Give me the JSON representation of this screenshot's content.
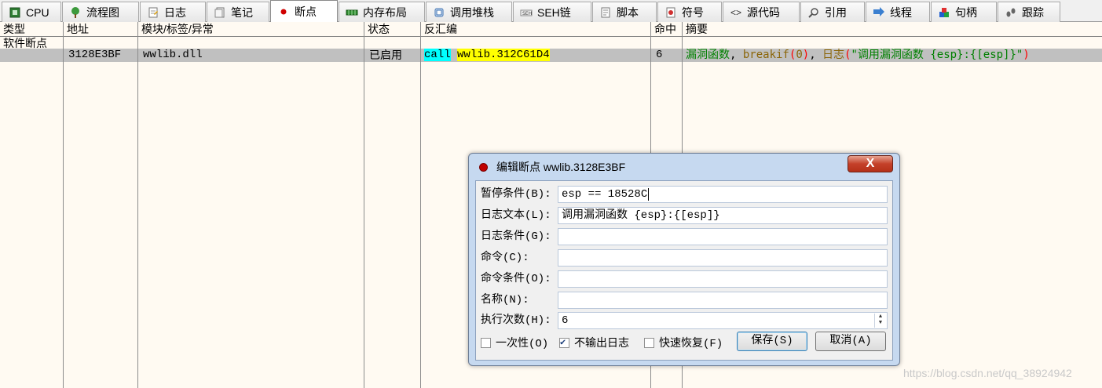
{
  "tabs": [
    {
      "label": "CPU",
      "icon": "cpu-icon"
    },
    {
      "label": "流程图",
      "icon": "tree-icon"
    },
    {
      "label": "日志",
      "icon": "log-icon"
    },
    {
      "label": "笔记",
      "icon": "note-icon"
    },
    {
      "label": "断点",
      "icon": "breakpoint-icon"
    },
    {
      "label": "内存布局",
      "icon": "memory-map-icon"
    },
    {
      "label": "调用堆栈",
      "icon": "call-stack-icon"
    },
    {
      "label": "SEH链",
      "icon": "seh-icon"
    },
    {
      "label": "脚本",
      "icon": "script-icon"
    },
    {
      "label": "符号",
      "icon": "symbol-icon"
    },
    {
      "label": "源代码",
      "icon": "source-icon"
    },
    {
      "label": "引用",
      "icon": "search-icon"
    },
    {
      "label": "线程",
      "icon": "thread-icon"
    },
    {
      "label": "句柄",
      "icon": "handle-icon"
    },
    {
      "label": "跟踪",
      "icon": "trace-icon"
    }
  ],
  "active_tab": "断点",
  "columns": [
    "类型",
    "地址",
    "模块/标签/异常",
    "状态",
    "反汇编",
    "命中",
    "摘要"
  ],
  "group_label": "软件断点",
  "row": {
    "address": "3128E3BF",
    "module": "wwlib.dll",
    "status": "已启用",
    "disasm_mnemonic": "call",
    "disasm_operand": "wwlib.312C61D4",
    "hits": "6",
    "summary_parts": [
      "漏洞函数",
      ", ",
      "breakif",
      "(",
      "0",
      ")",
      ", ",
      "日志",
      "(",
      "\"调用漏洞函数 {esp}:{[esp]}\"",
      ")"
    ]
  },
  "colors": {
    "row_highlight": "#c0c0c0",
    "mnemonic_bg": "#00ffff",
    "operand_bg": "#ffff00",
    "summary_green": "#008000",
    "summary_olive": "#8b6508",
    "summary_red": "#ff0000"
  },
  "dialog": {
    "title": "编辑断点 wwlib.3128E3BF",
    "close_label": "X",
    "fields": [
      {
        "label": "暂停条件(B):",
        "value": "esp == 18528C"
      },
      {
        "label": "日志文本(L):",
        "value": "调用漏洞函数 {esp}:{[esp]}"
      },
      {
        "label": "日志条件(G):",
        "value": ""
      },
      {
        "label": "命令(C):",
        "value": ""
      },
      {
        "label": "命令条件(O):",
        "value": ""
      },
      {
        "label": "名称(N):",
        "value": ""
      },
      {
        "label": "执行次数(H):",
        "value": "6"
      }
    ],
    "checkboxes": [
      {
        "label": "一次性(O)",
        "checked": false
      },
      {
        "label": "不输出日志",
        "checked": true
      },
      {
        "label": "快速恢复(F)",
        "checked": false
      }
    ],
    "save_label": "保存(S)",
    "cancel_label": "取消(A)"
  },
  "watermark": "https://blog.csdn.net/qq_38924942"
}
